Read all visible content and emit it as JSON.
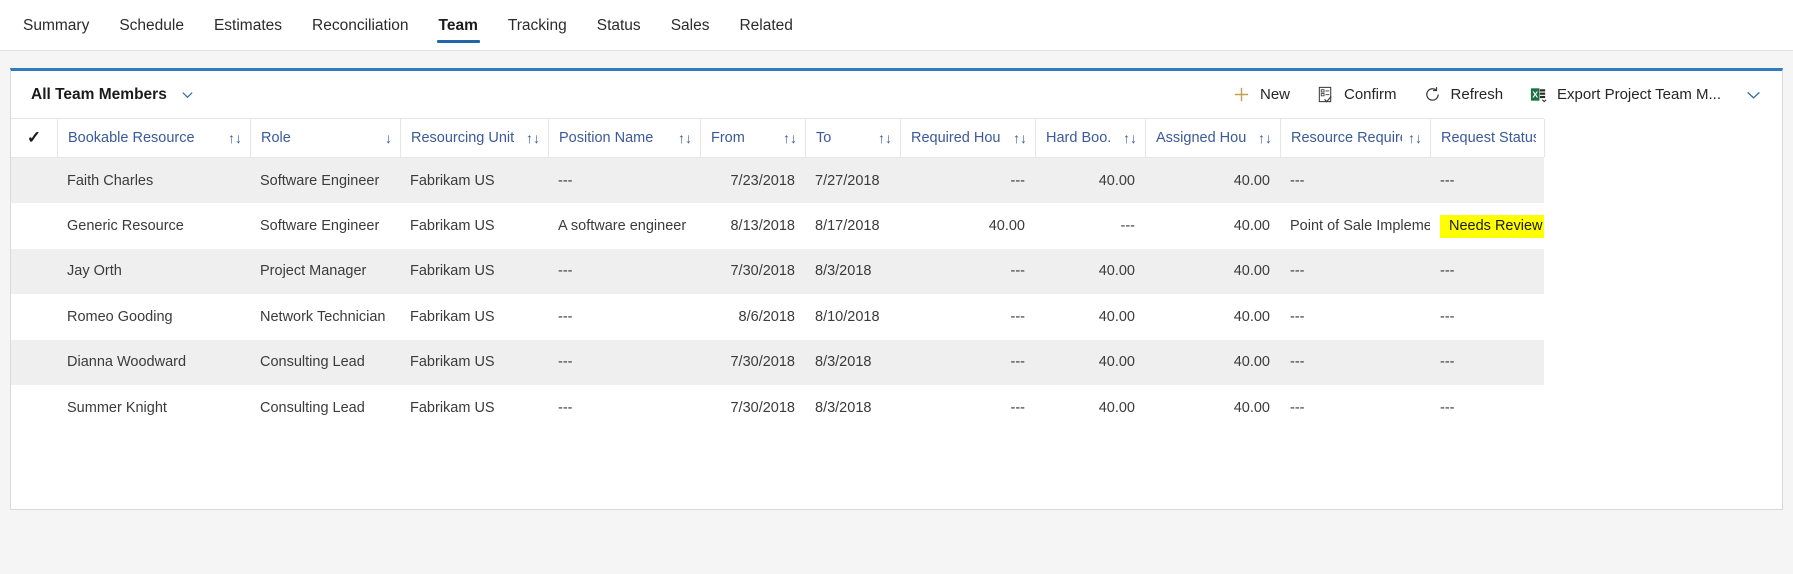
{
  "tabs": [
    {
      "label": "Summary",
      "active": false
    },
    {
      "label": "Schedule",
      "active": false
    },
    {
      "label": "Estimates",
      "active": false
    },
    {
      "label": "Reconciliation",
      "active": false
    },
    {
      "label": "Team",
      "active": true
    },
    {
      "label": "Tracking",
      "active": false
    },
    {
      "label": "Status",
      "active": false
    },
    {
      "label": "Sales",
      "active": false
    },
    {
      "label": "Related",
      "active": false
    }
  ],
  "commandbar": {
    "view_selector": "All Team Members",
    "view_chevron_icon": "chevron-down-icon",
    "buttons": [
      {
        "label": "New",
        "icon": "plus-icon"
      },
      {
        "label": "Confirm",
        "icon": "confirm-checklist-icon"
      },
      {
        "label": "Refresh",
        "icon": "refresh-icon"
      },
      {
        "label": "Export Project Team M...",
        "icon": "excel-export-icon"
      }
    ],
    "overflow_icon": "chevron-down-icon"
  },
  "grid": {
    "select_all_icon": "checkmark-icon",
    "columns": [
      {
        "label": "Bookable Resource",
        "sort": "unsorted",
        "align": "left"
      },
      {
        "label": "Role",
        "sort": "desc",
        "align": "left"
      },
      {
        "label": "Resourcing Unit",
        "sort": "unsorted",
        "align": "left"
      },
      {
        "label": "Position Name",
        "sort": "unsorted",
        "align": "left"
      },
      {
        "label": "From",
        "sort": "unsorted",
        "align": "left"
      },
      {
        "label": "To",
        "sort": "unsorted",
        "align": "left"
      },
      {
        "label": "Required Hours",
        "sort": "unsorted",
        "align": "right"
      },
      {
        "label": "Hard Boo...",
        "sort": "unsorted",
        "align": "right"
      },
      {
        "label": "Assigned Hours",
        "sort": "unsorted",
        "align": "right"
      },
      {
        "label": "Resource Require...",
        "sort": "unsorted",
        "align": "left"
      },
      {
        "label": "Request Status (...",
        "sort": "none",
        "align": "left"
      }
    ],
    "sort_glyphs": {
      "unsorted": "↑↓",
      "desc": "↓",
      "asc": "↑",
      "none": ""
    },
    "rows": [
      {
        "bookable_resource": "Faith Charles",
        "role": "Software Engineer",
        "resourcing_unit": "Fabrikam US",
        "position_name": "---",
        "from": "7/23/2018",
        "to": "7/27/2018",
        "required_hours": "---",
        "hard_booked_hours": "40.00",
        "assigned_hours": "40.00",
        "resource_requirement": "---",
        "request_status": "---",
        "request_status_highlight": false
      },
      {
        "bookable_resource": "Generic Resource",
        "role": "Software Engineer",
        "resourcing_unit": "Fabrikam US",
        "position_name": "A software engineer",
        "from": "8/13/2018",
        "to": "8/17/2018",
        "required_hours": "40.00",
        "hard_booked_hours": "---",
        "assigned_hours": "40.00",
        "resource_requirement": "Point of Sale Impleme...",
        "request_status": "Needs Review",
        "request_status_highlight": true
      },
      {
        "bookable_resource": "Jay Orth",
        "role": "Project Manager",
        "resourcing_unit": "Fabrikam US",
        "position_name": "---",
        "from": "7/30/2018",
        "to": "8/3/2018",
        "required_hours": "---",
        "hard_booked_hours": "40.00",
        "assigned_hours": "40.00",
        "resource_requirement": "---",
        "request_status": "---",
        "request_status_highlight": false
      },
      {
        "bookable_resource": "Romeo Gooding",
        "role": "Network Technician",
        "resourcing_unit": "Fabrikam US",
        "position_name": "---",
        "from": "8/6/2018",
        "to": "8/10/2018",
        "required_hours": "---",
        "hard_booked_hours": "40.00",
        "assigned_hours": "40.00",
        "resource_requirement": "---",
        "request_status": "---",
        "request_status_highlight": false
      },
      {
        "bookable_resource": "Dianna Woodward",
        "role": "Consulting Lead",
        "resourcing_unit": "Fabrikam US",
        "position_name": "---",
        "from": "7/30/2018",
        "to": "8/3/2018",
        "required_hours": "---",
        "hard_booked_hours": "40.00",
        "assigned_hours": "40.00",
        "resource_requirement": "---",
        "request_status": "---",
        "request_status_highlight": false
      },
      {
        "bookable_resource": "Summer Knight",
        "role": "Consulting Lead",
        "resourcing_unit": "Fabrikam US",
        "position_name": "---",
        "from": "7/30/2018",
        "to": "8/3/2018",
        "required_hours": "---",
        "hard_booked_hours": "40.00",
        "assigned_hours": "40.00",
        "resource_requirement": "---",
        "request_status": "---",
        "request_status_highlight": false
      }
    ]
  },
  "colors": {
    "accent": "#2b7cc0",
    "link": "#3b5a9a",
    "tab_underline": "#2266aa",
    "highlight": "#ffff00",
    "alt_row": "#efefef",
    "plus_icon": "#c2a14d"
  }
}
